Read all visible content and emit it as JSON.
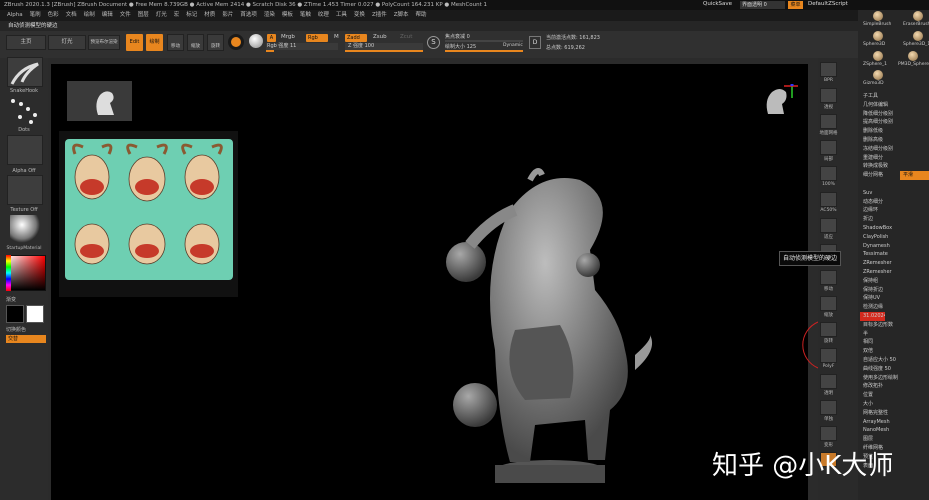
{
  "app": {
    "title_bar": "ZBrush 2020.1.3 [ZBrush]  ZBrush Document  ● Free Mem 8.739GB  ● Active Mem 2414  ● Scratch Disk 36  ● ZTime 1.453 Timer 0.027  ● PolyCount 164.231 KP  ● MeshCount 1",
    "quicksave": "QuickSave",
    "opacity_label": "界面透明 0",
    "menu_label": "菜单",
    "defaultzscript": "DefaultZScript"
  },
  "menu": [
    "Alpha",
    "笔刷",
    "色彩",
    "文档",
    "绘制",
    "编辑",
    "文件",
    "图层",
    "灯光",
    "宏",
    "标记",
    "材质",
    "影片",
    "首选项",
    "渲染",
    "模板",
    "笔触",
    "纹理",
    "工具",
    "变换",
    "Z插件",
    "Z脚本",
    "帮助"
  ],
  "tooltip_strip": "自动侦测模型的硬边",
  "toolbar": {
    "home": "主页",
    "lighting": "灯光",
    "preview_render": "预览布尔渲染",
    "edit": "Edit",
    "draw": "绘制",
    "move": "移动",
    "scale": "缩放",
    "rotate": "旋转",
    "a_label": "A",
    "mrgb": "Mrgb",
    "rgb": "Rgb",
    "m": "M",
    "zadd": "Zadd",
    "zsub": "Zsub",
    "zcut": "Zcut",
    "rgb_intensity": "Rgb 强度 11",
    "z_intensity": "Z 强度 100",
    "focal_shift": "焦点衰减 0",
    "draw_size": "绘制大小 125",
    "dynamic": "Dynamic",
    "active_points": "当前激活点数: 161,823",
    "total_points": "总点数: 619,262"
  },
  "left_panel": {
    "brush_name": "SnakeHook",
    "stroke_name": "Dots",
    "alpha_name": "Alpha Off",
    "texture_name": "Texture Off",
    "material_name": "StartupMaterial",
    "gradient_label": "渐变",
    "switch_color": "切换颜色",
    "alternate": "交替"
  },
  "right_shelf": [
    "BPR",
    "透视",
    "地面网格",
    "局部",
    "100%",
    "AC50%",
    "适应",
    "实际",
    "移动",
    "缩放",
    "旋转",
    "PolyF",
    "透明",
    "单独",
    "变形",
    "ghost"
  ],
  "right_panel": {
    "tools": [
      "SimpleBrush",
      "EraserBrush",
      "Sphere3D",
      "Sphere3D_1",
      "ZSphere_1",
      "PM3D_Sphere3D",
      "Gizmo3D"
    ],
    "items": [
      "子工具",
      "几何体编辑",
      "降低细分级别",
      "提高细分级别",
      "删除低级",
      "删除高级",
      "冻结细分级别",
      "重建细分",
      "转换成极致",
      "细分网格",
      "平滑",
      "Suv",
      "动态细分",
      "边缘环",
      "折边",
      "ShadowBox",
      "ClayPolish",
      "Dynamesh",
      "Tessimate",
      "ZRemesher",
      "ZRemesher",
      "保持组",
      "保持折边",
      "保持UV",
      "检测边缘",
      "31.02024",
      "目标多边形数",
      "半",
      "相同",
      "双倍",
      "自适应大小 50",
      "曲线强度 50",
      "使用多边形绘制",
      "修改拓扑",
      "位置",
      "大小",
      "网格完整性",
      "ArrayMesh",
      "NanoMesh",
      "图层",
      "纤维网格",
      "预览",
      "表面"
    ]
  },
  "tooltip": "自动侦测模型的硬边",
  "watermark": "知乎 @小K大师",
  "colors": {
    "accent": "#e8861e",
    "red": "#d42a1e",
    "bg": "#2a2a2a",
    "viewport": "#000000",
    "ref_bg": "#6ecfb2"
  }
}
